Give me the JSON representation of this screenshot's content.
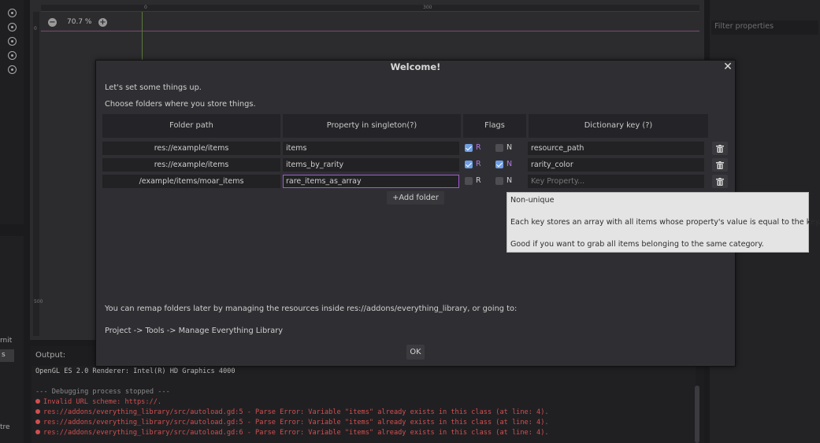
{
  "canvas": {
    "zoom": "70.7 %",
    "zoom_minus": "−",
    "zoom_plus": "+",
    "ruler_ticks": [
      "0",
      "300"
    ],
    "ruler_left_ticks": [
      "0",
      "500"
    ]
  },
  "inspector": {
    "filter_placeholder": "Filter properties"
  },
  "side_fragments": [
    "rnit",
    "s",
    "tre"
  ],
  "output": {
    "label": "Output:",
    "lines": [
      {
        "type": "normal",
        "text": "OpenGL ES 2.0 Renderer: Intel(R) HD Graphics 4000"
      },
      {
        "type": "dim",
        "text": "--- Debugging process stopped ---"
      },
      {
        "type": "error",
        "text": "Invalid URL scheme:  https://."
      },
      {
        "type": "error",
        "text": "res://addons/everything_library/src/autoload.gd:5 - Parse Error: Variable \"items\" already exists in this class (at line: 4)."
      },
      {
        "type": "error",
        "text": "res://addons/everything_library/src/autoload.gd:5 - Parse Error: Variable \"items\" already exists in this class (at line: 4)."
      },
      {
        "type": "error",
        "text": "res://addons/everything_library/src/autoload.gd:6 - Parse Error: Variable \"items\" already exists in this class (at line: 4)."
      }
    ]
  },
  "dialog": {
    "title": "Welcome!",
    "close": "✕",
    "intro1": "Let's set some things up.",
    "intro2": "Choose folders where you store things.",
    "headers": {
      "folder_path": "Folder path",
      "property": "Property in singleton(?)",
      "flags": "Flags",
      "dict_key": "Dictionary key (?)"
    },
    "rows": [
      {
        "folder": "res://example/items",
        "property": "items",
        "r": true,
        "n": false,
        "key": "resource_path",
        "key_placeholder": ""
      },
      {
        "folder": "res://example/items",
        "property": "items_by_rarity",
        "r": true,
        "n": true,
        "key": "rarity_color",
        "key_placeholder": ""
      },
      {
        "folder": "/example/items/moar_items",
        "property": "rare_items_as_array",
        "r": false,
        "n": false,
        "key": "",
        "key_placeholder": "Key Property..."
      }
    ],
    "flag_r": "R",
    "flag_n": "N",
    "add_folder": "Add folder",
    "footer1": "You can remap folders later by managing the resources inside res://addons/everything_library, or going to:",
    "footer2": "Project -> Tools -> Manage Everything Library",
    "ok": "OK"
  },
  "tooltip": {
    "title": "Non-unique",
    "line1": "Each key stores an array with all items whose property's value is equal to the key.",
    "line2": "Good if you want to grab all items belonging to the same category."
  },
  "colors": {
    "accent_checkbox": "#6e9fe6",
    "flag_on": "#b07ae3",
    "error": "#d24f4f",
    "focus_border": "#a25ad4"
  }
}
